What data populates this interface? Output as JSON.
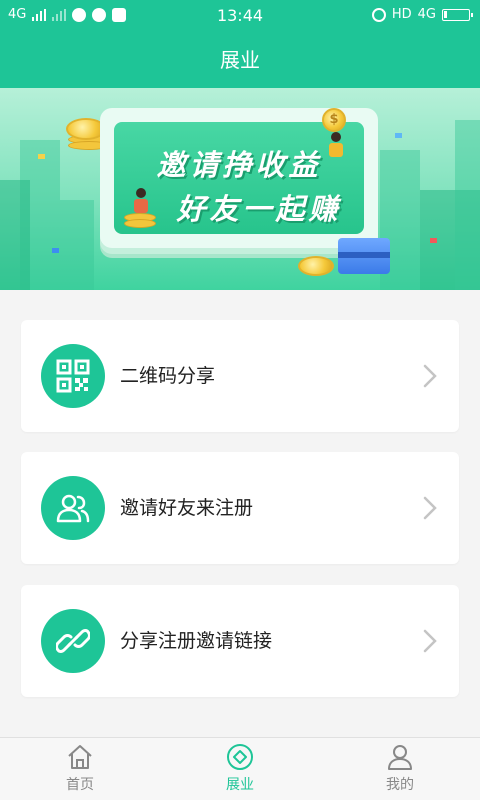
{
  "status_bar": {
    "net1": "4G",
    "time": "13:44",
    "hd": "HD",
    "net2": "4G"
  },
  "header": {
    "title": "展业"
  },
  "banner": {
    "line1": "邀请挣收益",
    "line2": "好友一起赚",
    "coin_symbol": "$"
  },
  "cards": [
    {
      "label": "二维码分享",
      "icon": "qr-code-icon"
    },
    {
      "label": "邀请好友来注册",
      "icon": "users-icon"
    },
    {
      "label": "分享注册邀请链接",
      "icon": "link-icon"
    }
  ],
  "nav": {
    "items": [
      {
        "label": "首页",
        "icon": "home-icon",
        "active": false
      },
      {
        "label": "展业",
        "icon": "business-icon",
        "active": true
      },
      {
        "label": "我的",
        "icon": "profile-icon",
        "active": false
      }
    ]
  },
  "colors": {
    "accent": "#1ec597",
    "text": "#222222",
    "muted": "#888888",
    "background": "#f4f4f4"
  }
}
